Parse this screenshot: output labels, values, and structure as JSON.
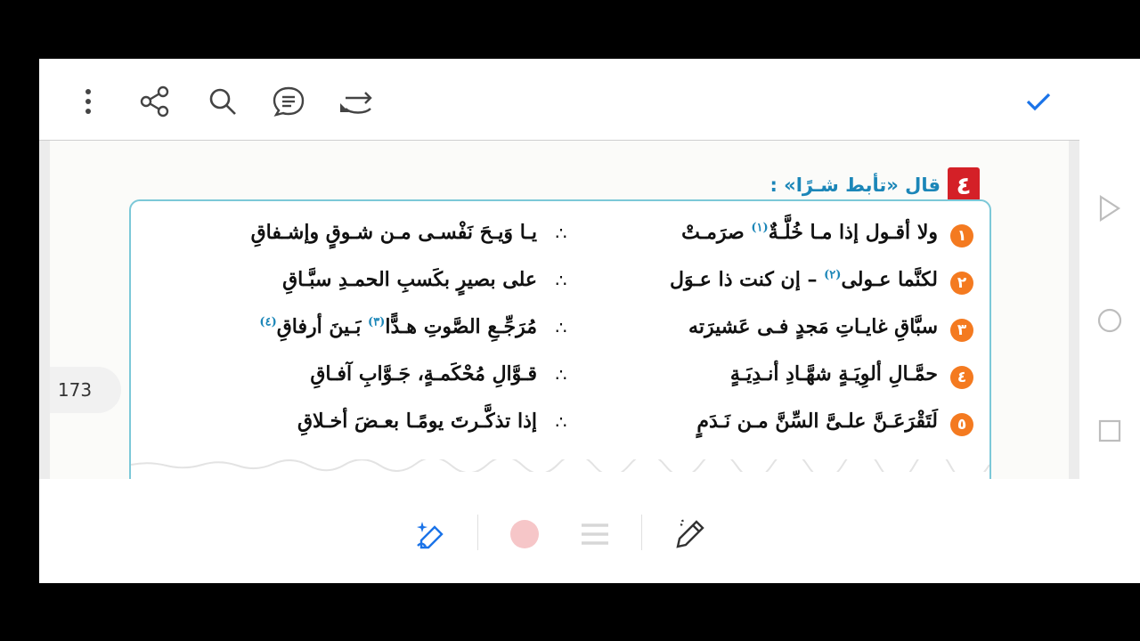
{
  "toolbar": {
    "icons": [
      "more-vertical-icon",
      "share-icon",
      "search-icon",
      "comment-icon",
      "undo-redo-icon",
      "check-icon"
    ],
    "accent": "#1a73e8"
  },
  "page": {
    "number": "173"
  },
  "question": {
    "number": "٤",
    "title": "قال «تأبط شـرًا» :"
  },
  "verses": [
    {
      "num": "١",
      "right": "ولا أقـول إذا مـا خُلَّـةٌ",
      "right_fn": "(١)",
      "right_end": " صرَمـتْ",
      "left": "يـا وَيـحَ نَفْسـى مـن شـوقٍ وإشـفاقِ",
      "left_fn": ""
    },
    {
      "num": "٢",
      "right": "لكنَّما عـولى",
      "right_fn": "(٢)",
      "right_end": " – إن كنت ذا عـوَل",
      "left": "على بصيرٍ بكَسبِ الحمـدِ سبَّـاقِ",
      "left_fn": ""
    },
    {
      "num": "٣",
      "right": "سبَّاقِ غايـاتِ مَجدٍ فـى عَشيرَته",
      "right_fn": "",
      "right_end": "",
      "left": "مُرَجِّـعِ الصَّوتِ هـدًّا",
      "left_fn": "(٣)",
      "left_end": " بَـينَ أرفاقِ",
      "left_fn2": "(٤)"
    },
    {
      "num": "٤",
      "right": "حمَّـالِ ألوِيَـةٍ شهَّـادِ أنـدِيَـةٍ",
      "right_fn": "",
      "right_end": "",
      "left": "قـوَّالِ مُحْكَمـةٍ، جَـوَّابِ آفـاقِ",
      "left_fn": ""
    },
    {
      "num": "٥",
      "right": "لَتَقْرَعَـنَّ علـىَّ السِّنَّ مـن نَـدَمٍ",
      "right_fn": "",
      "right_end": "",
      "left": "إذا تذكَّـرتَ يومًـا بعـضَ أخـلاقِ",
      "left_fn": ""
    }
  ],
  "separator": "∴",
  "bottom": {
    "icons": [
      "ai-sparkle-pen-icon",
      "color-dot-icon",
      "lines-icon",
      "pencil-icon"
    ],
    "color_dot": "#f6c6c8"
  },
  "nav": {
    "icons": [
      "back-triangle-icon",
      "home-circle-icon",
      "recents-square-icon"
    ]
  }
}
